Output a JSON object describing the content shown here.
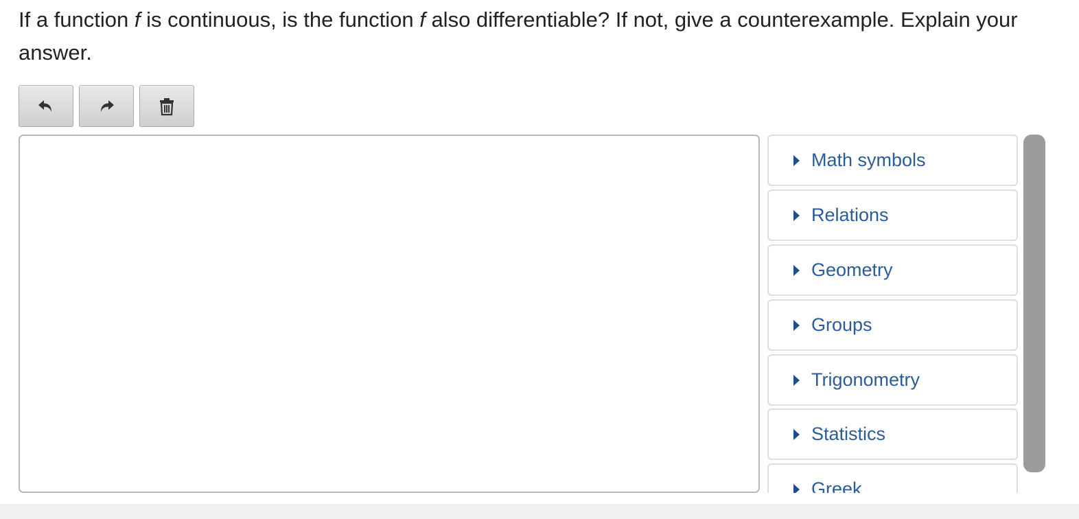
{
  "question": {
    "part1": "If a function ",
    "var1": "f",
    "part2": " is continuous, is the function ",
    "var2": "f",
    "part3": " also differentiable? If not, give a counterexample. Explain your answer."
  },
  "toolbar": {
    "undo_icon": "undo-arrow",
    "redo_icon": "redo-arrow",
    "clear_icon": "trash"
  },
  "editor": {
    "value": ""
  },
  "palette": {
    "items": [
      {
        "label": "Math symbols"
      },
      {
        "label": "Relations"
      },
      {
        "label": "Geometry"
      },
      {
        "label": "Groups"
      },
      {
        "label": "Trigonometry"
      },
      {
        "label": "Statistics"
      },
      {
        "label": "Greek"
      }
    ]
  },
  "colors": {
    "accent": "#2b5c9a",
    "caret": "#1f4e8c",
    "scrollbar": "#9c9c9c"
  }
}
